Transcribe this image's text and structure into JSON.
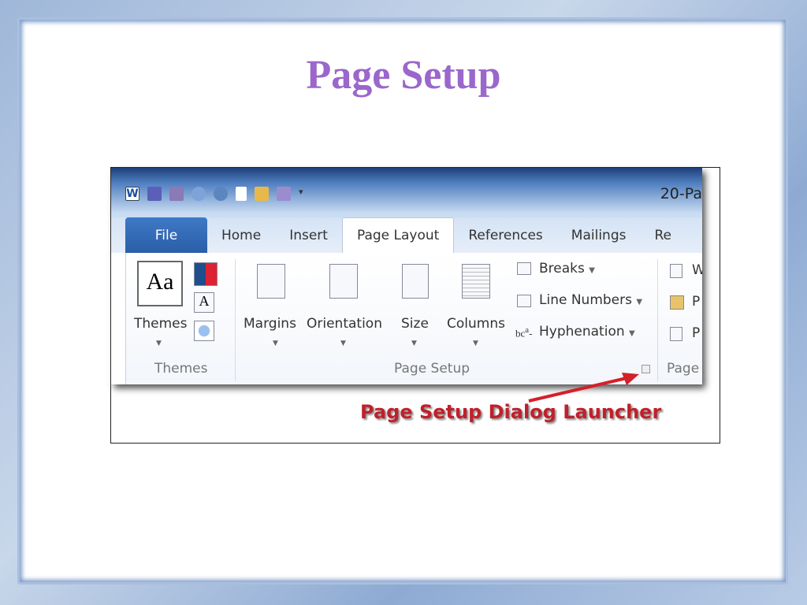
{
  "slide": {
    "title": "Page Setup"
  },
  "window": {
    "title": "20-Pa",
    "qat_icons": [
      "word-icon",
      "save-icon",
      "print-preview-icon",
      "undo-icon",
      "redo-icon",
      "new-document-icon",
      "open-folder-icon",
      "format-icon",
      "customize-icon"
    ]
  },
  "tabs": [
    "File",
    "Home",
    "Insert",
    "Page Layout",
    "References",
    "Mailings",
    "Re"
  ],
  "active_tab": "Page Layout",
  "ribbon": {
    "themes_group": {
      "themes_label": "Themes",
      "group_label": "Themes"
    },
    "page_setup_group": {
      "margins": "Margins",
      "orientation": "Orientation",
      "size": "Size",
      "columns": "Columns",
      "breaks": "Breaks",
      "line_numbers": "Line Numbers",
      "hyphenation": "Hyphenation",
      "group_label": "Page Setup"
    },
    "page_bg_group": {
      "item1": "W",
      "item2": "P",
      "item3": "P",
      "group_label": "Page"
    }
  },
  "annotation": {
    "caption": "Page Setup Dialog Launcher",
    "color": "#d4202a"
  },
  "colors": {
    "title": "#9a67cc",
    "file_tab": "#2f67b3"
  }
}
